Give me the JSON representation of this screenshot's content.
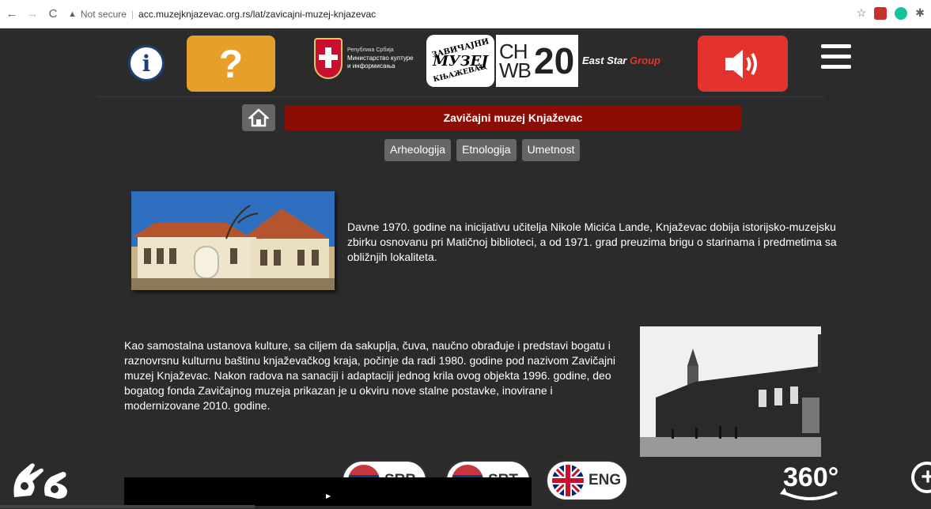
{
  "browser": {
    "back_icon": "←",
    "forward_icon": "→",
    "reload_icon": "C",
    "security_icon": "▲",
    "security_label": "Not secure",
    "url": "acc.muzejknjazevac.org.rs/lat/zavicajni-muzej-knjazevac",
    "star_icon": "☆",
    "puzzle_icon": "✱",
    "colors": {
      "ext_pdf": "#c9302c",
      "ext_grammarly": "#15c39a"
    }
  },
  "header": {
    "info_label": "i",
    "help_label": "?",
    "serbia": {
      "line1": "Република Србија",
      "line2": "Министарство културе",
      "line3": "и информисања"
    },
    "muzej_logo": {
      "top": "ЗАВИЧАЈНИ",
      "mid": "МУЗЕЈ",
      "bot": "КЊАЖЕВАЦ"
    },
    "chwb_logo": {
      "letters": "CH WB",
      "number": "20"
    },
    "eaststar": {
      "main": "East Star",
      "accent": "Group"
    },
    "colors": {
      "help": "#e6a02a",
      "sound": "#e4332c",
      "title_bar": "#8b0e06"
    }
  },
  "title": "Zavičajni muzej Knjaževac",
  "subnav": [
    "Arheologija",
    "Etnologija",
    "Umetnost"
  ],
  "paragraph1": "Davne 1970. godine na inicijativu učitelja Nikole Micića Lande, Knjaževac dobija istorijsko-muzejsku zbirku osnovanu pri Matičnoj biblioteci, a od 1971. grad preuzima brigu o starinama i predmetima sa obližnjih lokaliteta.",
  "paragraph2": "Kao samostalna ustanova kulture, sa ciljem da sakuplja, čuva, naučno obrađuje i predstavi bogatu i raznovrsnu kulturnu baštinu knjaževačkog kraja, počinje da radi 1980. godine pod nazivom Zavičajni muzej Knjaževac. Nakon radova na sanaciji i adaptaciji jednog krila ovog objekta 1996. godine, deo bogatog fonda Zavičajnog muzeja prikazan je u okviru nove stalne postavke, inovirane i modernizovane 2010. godine.",
  "languages": [
    {
      "label": "SRB"
    },
    {
      "label": "SRЋ"
    },
    {
      "label": "ENG"
    }
  ],
  "footer": {
    "vr_label": "360°",
    "play_icon": "▶",
    "zoom_label": "+"
  }
}
